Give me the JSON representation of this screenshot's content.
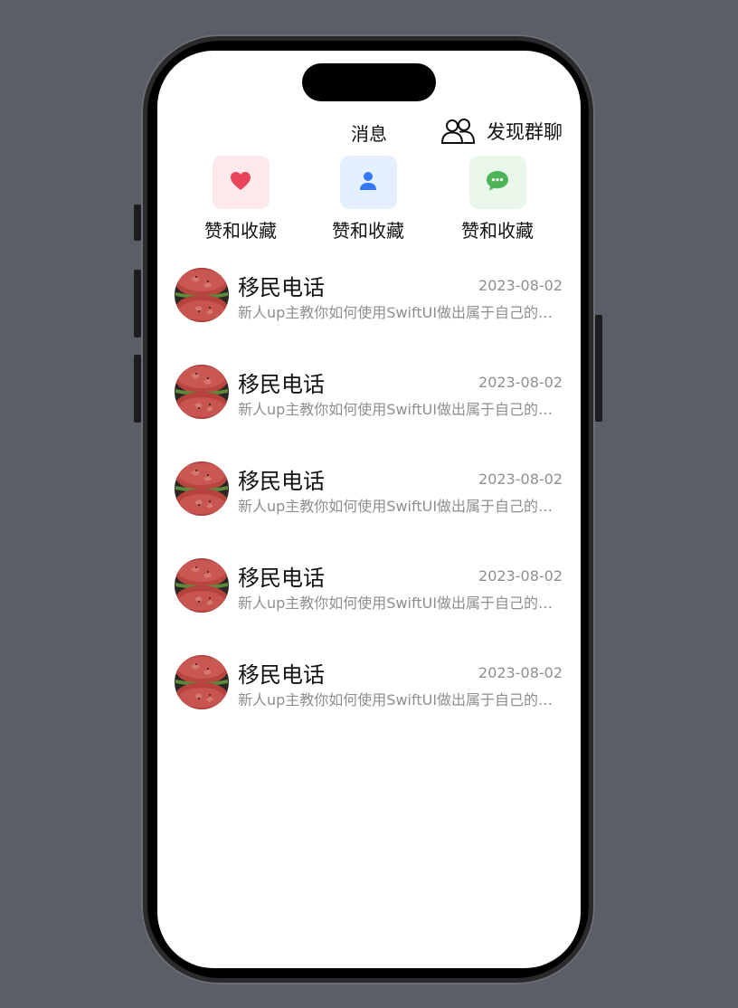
{
  "nav": {
    "title": "消息",
    "action_label": "发现群聊",
    "action_icon": "group-people-icon"
  },
  "quick_actions": [
    {
      "label": "赞和收藏",
      "icon": "heart-icon",
      "icon_color": "#e8455b",
      "bg_color": "#fde9ec"
    },
    {
      "label": "赞和收藏",
      "icon": "person-icon",
      "icon_color": "#3478f6",
      "bg_color": "#e4efff"
    },
    {
      "label": "赞和收藏",
      "icon": "chat-bubble-icon",
      "icon_color": "#4cb456",
      "bg_color": "#e8f7ea"
    }
  ],
  "messages": [
    {
      "name": "移民电话",
      "date": "2023-08-02",
      "preview": "新人up主教你如何使用SwiftUI做出属于自己的App",
      "avatar": "watermelon-avatar"
    },
    {
      "name": "移民电话",
      "date": "2023-08-02",
      "preview": "新人up主教你如何使用SwiftUI做出属于自己的App",
      "avatar": "watermelon-avatar"
    },
    {
      "name": "移民电话",
      "date": "2023-08-02",
      "preview": "新人up主教你如何使用SwiftUI做出属于自己的App",
      "avatar": "watermelon-avatar"
    },
    {
      "name": "移民电话",
      "date": "2023-08-02",
      "preview": "新人up主教你如何使用SwiftUI做出属于自己的App",
      "avatar": "watermelon-avatar"
    },
    {
      "name": "移民电话",
      "date": "2023-08-02",
      "preview": "新人up主教你如何使用SwiftUI做出属于自己的App",
      "avatar": "watermelon-avatar"
    }
  ]
}
